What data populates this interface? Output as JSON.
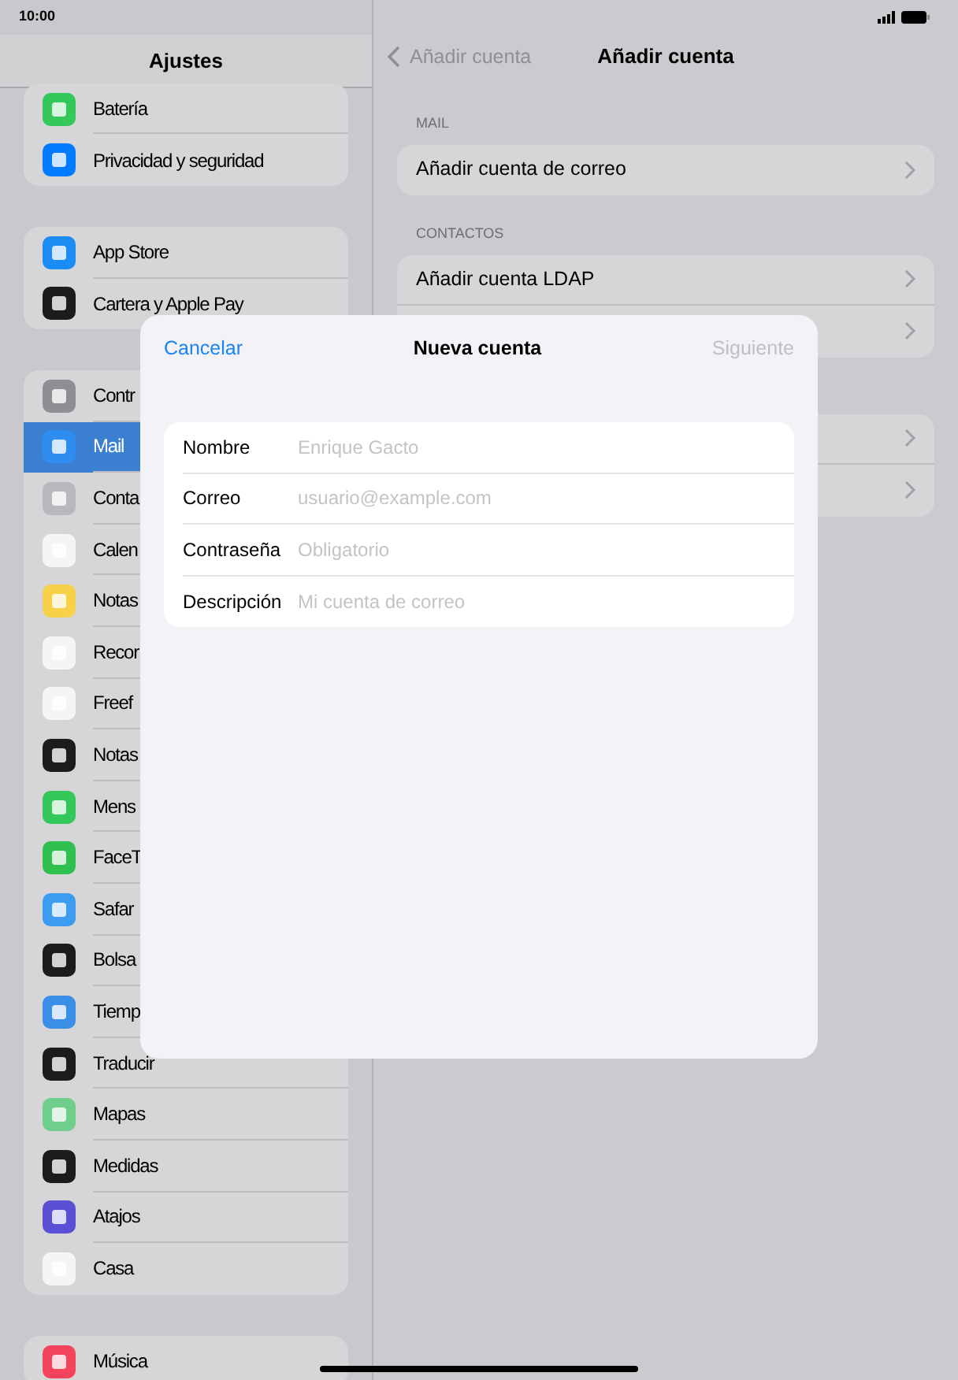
{
  "status_bar": {
    "time": "10:00"
  },
  "sidebar": {
    "title": "Ajustes",
    "groups": [
      {
        "items": [
          {
            "label": "Batería",
            "color": "#34c759",
            "selected": false
          },
          {
            "label": "Privacidad y seguridad",
            "color": "#007aff",
            "selected": false
          }
        ]
      },
      {
        "items": [
          {
            "label": "App Store",
            "color": "#1c8cf5",
            "selected": false
          },
          {
            "label": "Cartera y Apple Pay",
            "color": "#1c1c1e",
            "selected": false
          }
        ]
      },
      {
        "items": [
          {
            "label": "Contr",
            "color": "#8e8e93",
            "selected": false
          },
          {
            "label": "Mail",
            "color": "#2f8cf0",
            "selected": true
          },
          {
            "label": "Conta",
            "color": "#b8b8bc",
            "selected": false
          },
          {
            "label": "Calen",
            "color": "#f5f5f5",
            "selected": false
          },
          {
            "label": "Notas",
            "color": "#f7d14a",
            "selected": false
          },
          {
            "label": "Recor",
            "color": "#f5f5f5",
            "selected": false
          },
          {
            "label": "Freef",
            "color": "#f5f5f5",
            "selected": false
          },
          {
            "label": "Notas",
            "color": "#1c1c1e",
            "selected": false
          },
          {
            "label": "Mens",
            "color": "#34c759",
            "selected": false
          },
          {
            "label": "FaceT",
            "color": "#30c04f",
            "selected": false
          },
          {
            "label": "Safar",
            "color": "#3d9bf0",
            "selected": false
          },
          {
            "label": "Bolsa",
            "color": "#1c1c1e",
            "selected": false
          },
          {
            "label": "Tiemp",
            "color": "#3a8ee6",
            "selected": false
          },
          {
            "label": "Traducir",
            "color": "#1c1c1e",
            "selected": false
          },
          {
            "label": "Mapas",
            "color": "#6fcf8a",
            "selected": false
          },
          {
            "label": "Medidas",
            "color": "#1c1c1e",
            "selected": false
          },
          {
            "label": "Atajos",
            "color": "#5b4fd6",
            "selected": false
          },
          {
            "label": "Casa",
            "color": "#f5f5f5",
            "selected": false
          }
        ]
      },
      {
        "items": [
          {
            "label": "Música",
            "color": "#f2445a",
            "selected": false
          }
        ]
      }
    ]
  },
  "detail": {
    "back": "Añadir cuenta",
    "title": "Añadir cuenta",
    "groups": [
      {
        "header": "MAIL",
        "rows": [
          {
            "label": "Añadir cuenta de correo"
          }
        ]
      },
      {
        "header": "CONTACTOS",
        "rows": [
          {
            "label": "Añadir cuenta LDAP"
          },
          {}
        ]
      },
      {
        "rows": [
          {},
          {}
        ]
      }
    ]
  },
  "dialog": {
    "cancel": "Cancelar",
    "title": "Nueva cuenta",
    "next": {
      "label": "Siguiente",
      "disabled": true
    },
    "fields": [
      {
        "label": "Nombre",
        "placeholder": "Enrique Gacto"
      },
      {
        "label": "Correo",
        "placeholder": "usuario@example.com"
      },
      {
        "label": "Contraseña",
        "placeholder": "Obligatorio"
      },
      {
        "label": "Descripción",
        "placeholder": "Mi cuenta de correo"
      }
    ]
  }
}
